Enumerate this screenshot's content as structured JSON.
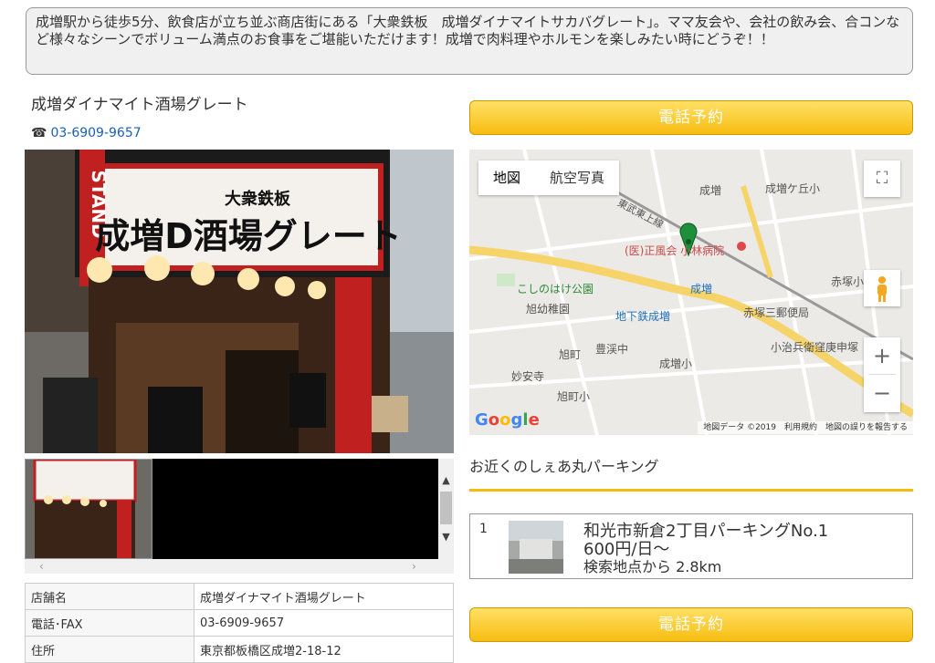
{
  "intro": "成増駅から徒歩5分、飲食店が立ち並ぶ商店街にある「大衆鉄板　成増ダイナマイトサカバグレート」。ママ友会や、会社の飲み会、合コンなど様々なシーンでボリューム満点のお食事をご堪能いただけます！成増で肉料理やホルモンを楽しみたい時にどうぞ！！",
  "shop": {
    "title": "成増ダイナマイト酒場グレート",
    "phone_icon": "☎",
    "phone": "03-6909-9657",
    "sign_main": "成増D酒場グレート",
    "sign_top": "大衆鉄板",
    "sign_side": "STAND"
  },
  "info_table": [
    {
      "key": "店舗名",
      "value": "成増ダイナマイト酒場グレート"
    },
    {
      "key": "電話･FAX",
      "value": "03-6909-9657"
    },
    {
      "key": "住所",
      "value": "東京都板橋区成増2-18-12"
    }
  ],
  "call_button": "電話予約",
  "map": {
    "tab_map": "地図",
    "tab_aerial": "航空写真",
    "attribution": "地図データ ©2019　利用規約　地図の誤りを報告する",
    "labels": {
      "hospital": "(医)正風会 小林病院",
      "park": "こしのはけ公園",
      "kindergarten": "旭幼稚園",
      "subway": "地下鉄成増",
      "narimasu": "成増",
      "narimasu_station": "成増",
      "akatsuka_post": "赤塚三郵便局",
      "koji": "小治兵衛窪庚申塚",
      "asahicho": "旭町",
      "toyokei": "豊渓中",
      "myoanji": "妙安寺",
      "asahi_elem": "旭町小",
      "narimasu_elem": "成増小",
      "narimasugaoka": "成増ケ丘小",
      "akatsuka": "赤塚小",
      "tobu": "東武東上線",
      "seishin": "成増",
      "narimasu_top": "成増"
    }
  },
  "parking": {
    "title": "お近くのしぇあ丸パーキング",
    "items": [
      {
        "num": "1",
        "name": "和光市新倉2丁目パーキングNo.1",
        "price": "600円/日～",
        "distance": "検索地点から 2.8km"
      }
    ]
  },
  "colors": {
    "accent": "#f6b90d",
    "link": "#1a5fb4"
  }
}
